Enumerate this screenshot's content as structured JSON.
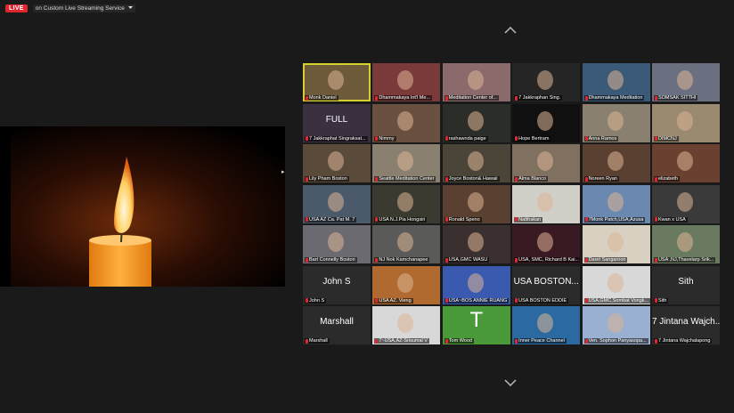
{
  "topbar": {
    "live": "LIVE",
    "streaming": "on Custom Live Streaming Service",
    "dropdown_icon": "caret-down-icon"
  },
  "participants": [
    {
      "name": "Monk Daniel",
      "bg": "#6d5a3a",
      "active": true
    },
    {
      "name": "Dhammakaya Int'l Me...",
      "bg": "#7a3a3a"
    },
    {
      "name": "Meditation Center of...",
      "bg": "#8a6a6a"
    },
    {
      "name": "7 Jakkraphan Sing.",
      "bg": "#252525"
    },
    {
      "name": "Dhammakaya Meditation",
      "bg": "#3a5a78"
    },
    {
      "name": "SOMSAK SITTHI",
      "bg": "#6a7080"
    },
    {
      "name": "7 Jakkraphat Singraksat...",
      "bg": "#3a3040",
      "big": "FULL"
    },
    {
      "name": "Nimmy",
      "bg": "#6a5040"
    },
    {
      "name": "rashawnda paige",
      "bg": "#2a2d28"
    },
    {
      "name": "Hope Bertram",
      "bg": "#101010"
    },
    {
      "name": "Anna Ramos",
      "bg": "#8a8070"
    },
    {
      "name": "DIMCNJ",
      "bg": "#9a8a70"
    },
    {
      "name": "Lily Pham Boston",
      "bg": "#5a4a3a"
    },
    {
      "name": "Seattle Meditation Center",
      "bg": "#8a8070"
    },
    {
      "name": "Joyce Boston& Hawaii",
      "bg": "#4a4538"
    },
    {
      "name": "Alma Blanco",
      "bg": "#807060"
    },
    {
      "name": "Noreen Ryan",
      "bg": "#5a4030"
    },
    {
      "name": "elizabeth",
      "bg": "#6a4030"
    },
    {
      "name": "USA AZ Ca. Pat M. 7",
      "bg": "#4a5a6a"
    },
    {
      "name": "USA N.J.Pia Hongsiri",
      "bg": "#3a3a30"
    },
    {
      "name": "Ronald Speno",
      "bg": "#5a4030"
    },
    {
      "name": "Natthakan",
      "bg": "#d0cfc8"
    },
    {
      "name": "7Monk Patch,USA,Azusa",
      "bg": "#6a88b0"
    },
    {
      "name": "Kwan x USA",
      "bg": "#3a3a3a"
    },
    {
      "name": "Bart Connelly Boston",
      "bg": "#6a6a70"
    },
    {
      "name": "NJ Nok Kamchanapee",
      "bg": "#5a5a58"
    },
    {
      "name": "USA,GMC WASU",
      "bg": "#3a3030"
    },
    {
      "name": "USA, SMC, Richard B Kai...",
      "bg": "#3a1a22"
    },
    {
      "name": "Daret Sangaroon",
      "bg": "#d8d0c0"
    },
    {
      "name": "USA ,NJ,Thavelarp Srik...",
      "bg": "#6a7a60"
    },
    {
      "name": "John S",
      "bg": "#2b2b2b",
      "big": "John S"
    },
    {
      "name": "USA AZ. Vieng",
      "bg": "#b06a30"
    },
    {
      "name": "USA~BOS ANNIE RUANG",
      "bg": "#3a5ab0"
    },
    {
      "name": "USA BOSTON  EDDIE",
      "bg": "#2b2b2b",
      "big": "USA BOSTON..."
    },
    {
      "name": "USA,GMC,Sombat Vongk...",
      "bg": "#d8d8d8"
    },
    {
      "name": "Sith",
      "bg": "#2b2b2b",
      "big": "Sith"
    },
    {
      "name": "Marshall",
      "bg": "#2b2b2b",
      "big": "Marshall"
    },
    {
      "name": "7~USA,AZ-Srisumal V",
      "bg": "#d8d8d8"
    },
    {
      "name": "Tom Wood",
      "bg": "#4a9a3a",
      "letter": "T"
    },
    {
      "name": "Inner Peace Channel",
      "bg": "#2a6aa0"
    },
    {
      "name": "Ven. Sophon Panyasopa...",
      "bg": "#9ab0d0"
    },
    {
      "name": "7 Jintana Wajchalapong",
      "bg": "#2b2b2b",
      "big": "7 Jintana Wajch..."
    }
  ]
}
